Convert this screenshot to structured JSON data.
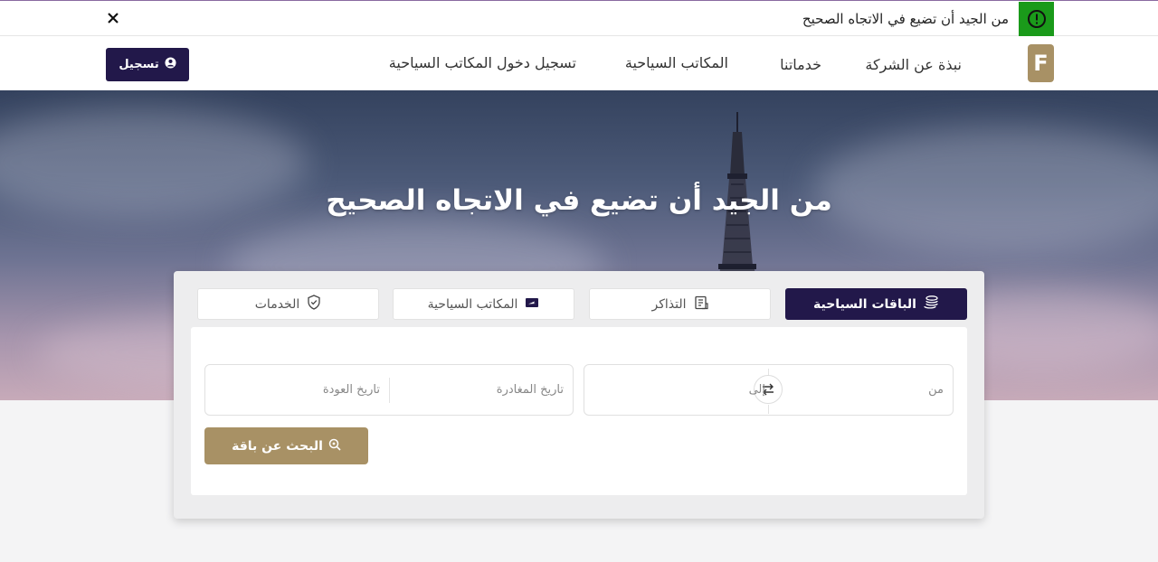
{
  "announcement": {
    "text": "من الجيد أن تضيع في الاتجاه الصحيح",
    "icon": "exclamation-circle-icon",
    "close_icon": "close-icon",
    "icon_bg": "#1a9a1a"
  },
  "navbar": {
    "logo": "F",
    "links": [
      "نبذة عن الشركة",
      "خدماتنا",
      "المكاتب السياحية",
      "تسجيل دخول المكاتب السياحية"
    ],
    "register_label": "تسجيل",
    "register_icon": "user-circle-icon"
  },
  "hero": {
    "title": "من الجيد أن تضيع في الاتجاه الصحيح"
  },
  "tabs": [
    {
      "label": "الباقات السياحية",
      "icon": "coins-icon",
      "active": true
    },
    {
      "label": "التذاكر",
      "icon": "ticket-icon",
      "active": false
    },
    {
      "label": "المكاتب السياحية",
      "icon": "ticket-plane-icon",
      "active": false
    },
    {
      "label": "الخدمات",
      "icon": "shield-check-icon",
      "active": false
    }
  ],
  "search_form": {
    "from_placeholder": "من",
    "to_placeholder": "إلى",
    "departure_placeholder": "تاريخ المغادرة",
    "return_placeholder": "تاريخ العودة",
    "swap_icon": "swap-arrows-icon",
    "submit_label": "البحث عن باقة",
    "submit_icon": "search-icon"
  },
  "colors": {
    "primary": "#22184a",
    "accent": "#a89165"
  }
}
